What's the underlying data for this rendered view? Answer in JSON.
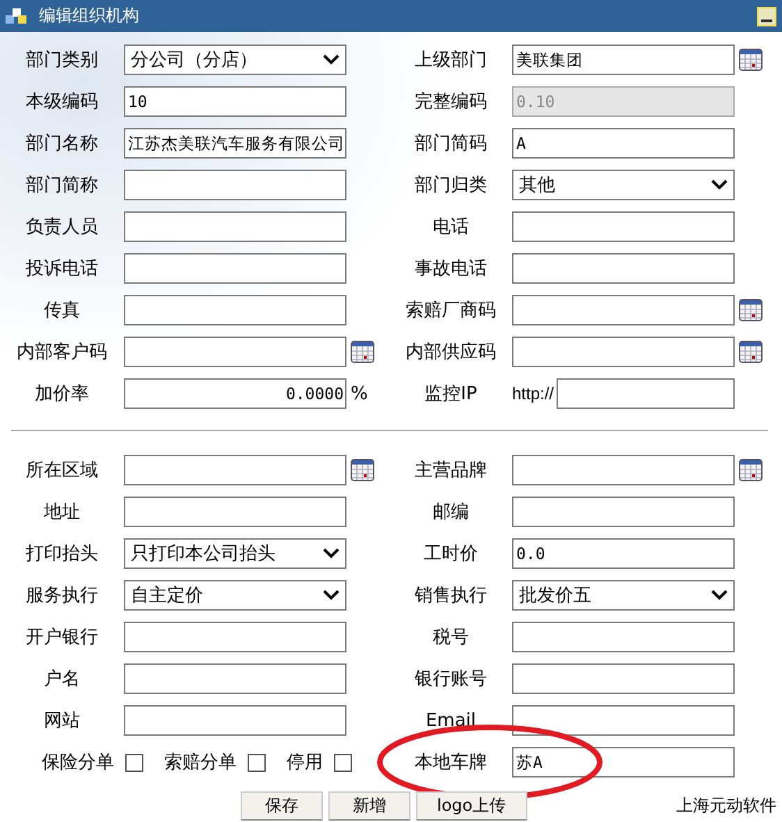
{
  "window": {
    "title": "编辑组织机构"
  },
  "sections": [
    [
      {
        "label": "部门类别",
        "kind": "select",
        "value": "分公司（分店）",
        "lookup": false
      },
      {
        "label": "上级部门",
        "kind": "input",
        "value": "美联集团",
        "lookup": true
      },
      {
        "label": "本级编码",
        "kind": "input",
        "value": "10",
        "lookup": false
      },
      {
        "label": "完整编码",
        "kind": "readonly",
        "value": "0.10",
        "lookup": false
      },
      {
        "label": "部门名称",
        "kind": "input",
        "value": "江苏杰美联汽车服务有限公司",
        "lookup": false
      },
      {
        "label": "部门简码",
        "kind": "input",
        "value": "A",
        "lookup": false
      },
      {
        "label": "部门简称",
        "kind": "input",
        "lookup": false
      },
      {
        "label": "部门归类",
        "kind": "select",
        "value": "其他",
        "lookup": false
      },
      {
        "label": "负责人员",
        "kind": "input",
        "lookup": false
      },
      {
        "label": "电话",
        "kind": "input",
        "lookup": false
      },
      {
        "label": "投诉电话",
        "kind": "input",
        "lookup": false
      },
      {
        "label": "事故电话",
        "kind": "input",
        "lookup": false
      },
      {
        "label": "传真",
        "kind": "input",
        "lookup": false
      },
      {
        "label": "索赔厂商码",
        "kind": "input",
        "lookup": true
      },
      {
        "label": "内部客户码",
        "kind": "input",
        "lookup": true
      },
      {
        "label": "内部供应码",
        "kind": "input",
        "lookup": true
      },
      {
        "label": "加价率",
        "kind": "number",
        "value": "0.0000",
        "suffix": "%",
        "lookup": false
      },
      {
        "label": "监控IP",
        "kind": "url",
        "prefix": "http://",
        "lookup": false
      }
    ],
    [
      {
        "label": "所在区域",
        "kind": "input",
        "lookup": true
      },
      {
        "label": "主营品牌",
        "kind": "input",
        "lookup": true
      },
      {
        "label": "地址",
        "kind": "input",
        "lookup": false
      },
      {
        "label": "邮编",
        "kind": "input",
        "lookup": false
      },
      {
        "label": "打印抬头",
        "kind": "select",
        "value": "只打印本公司抬头",
        "lookup": false
      },
      {
        "label": "工时价",
        "kind": "input",
        "value": "0.0",
        "lookup": false
      },
      {
        "label": "服务执行",
        "kind": "select",
        "value": "自主定价",
        "lookup": false
      },
      {
        "label": "销售执行",
        "kind": "select",
        "value": "批发价五",
        "lookup": false
      },
      {
        "label": "开户银行",
        "kind": "input",
        "lookup": false
      },
      {
        "label": "税号",
        "kind": "input",
        "lookup": false
      },
      {
        "label": "户名",
        "kind": "input",
        "lookup": false
      },
      {
        "label": "银行账号",
        "kind": "input",
        "lookup": false
      },
      {
        "label": "网站",
        "kind": "input",
        "lookup": false
      },
      {
        "label": "Email",
        "kind": "input",
        "lookup": false
      }
    ]
  ],
  "checkboxes": [
    {
      "label": "保险分单",
      "checked": false
    },
    {
      "label": "索赔分单",
      "checked": false
    },
    {
      "label": "停用",
      "checked": false
    }
  ],
  "plate": {
    "label": "本地车牌",
    "value": "苏A",
    "circled": true
  },
  "buttons": [
    "保存",
    "新增",
    "logo上传"
  ],
  "credit": "上海元动软件"
}
